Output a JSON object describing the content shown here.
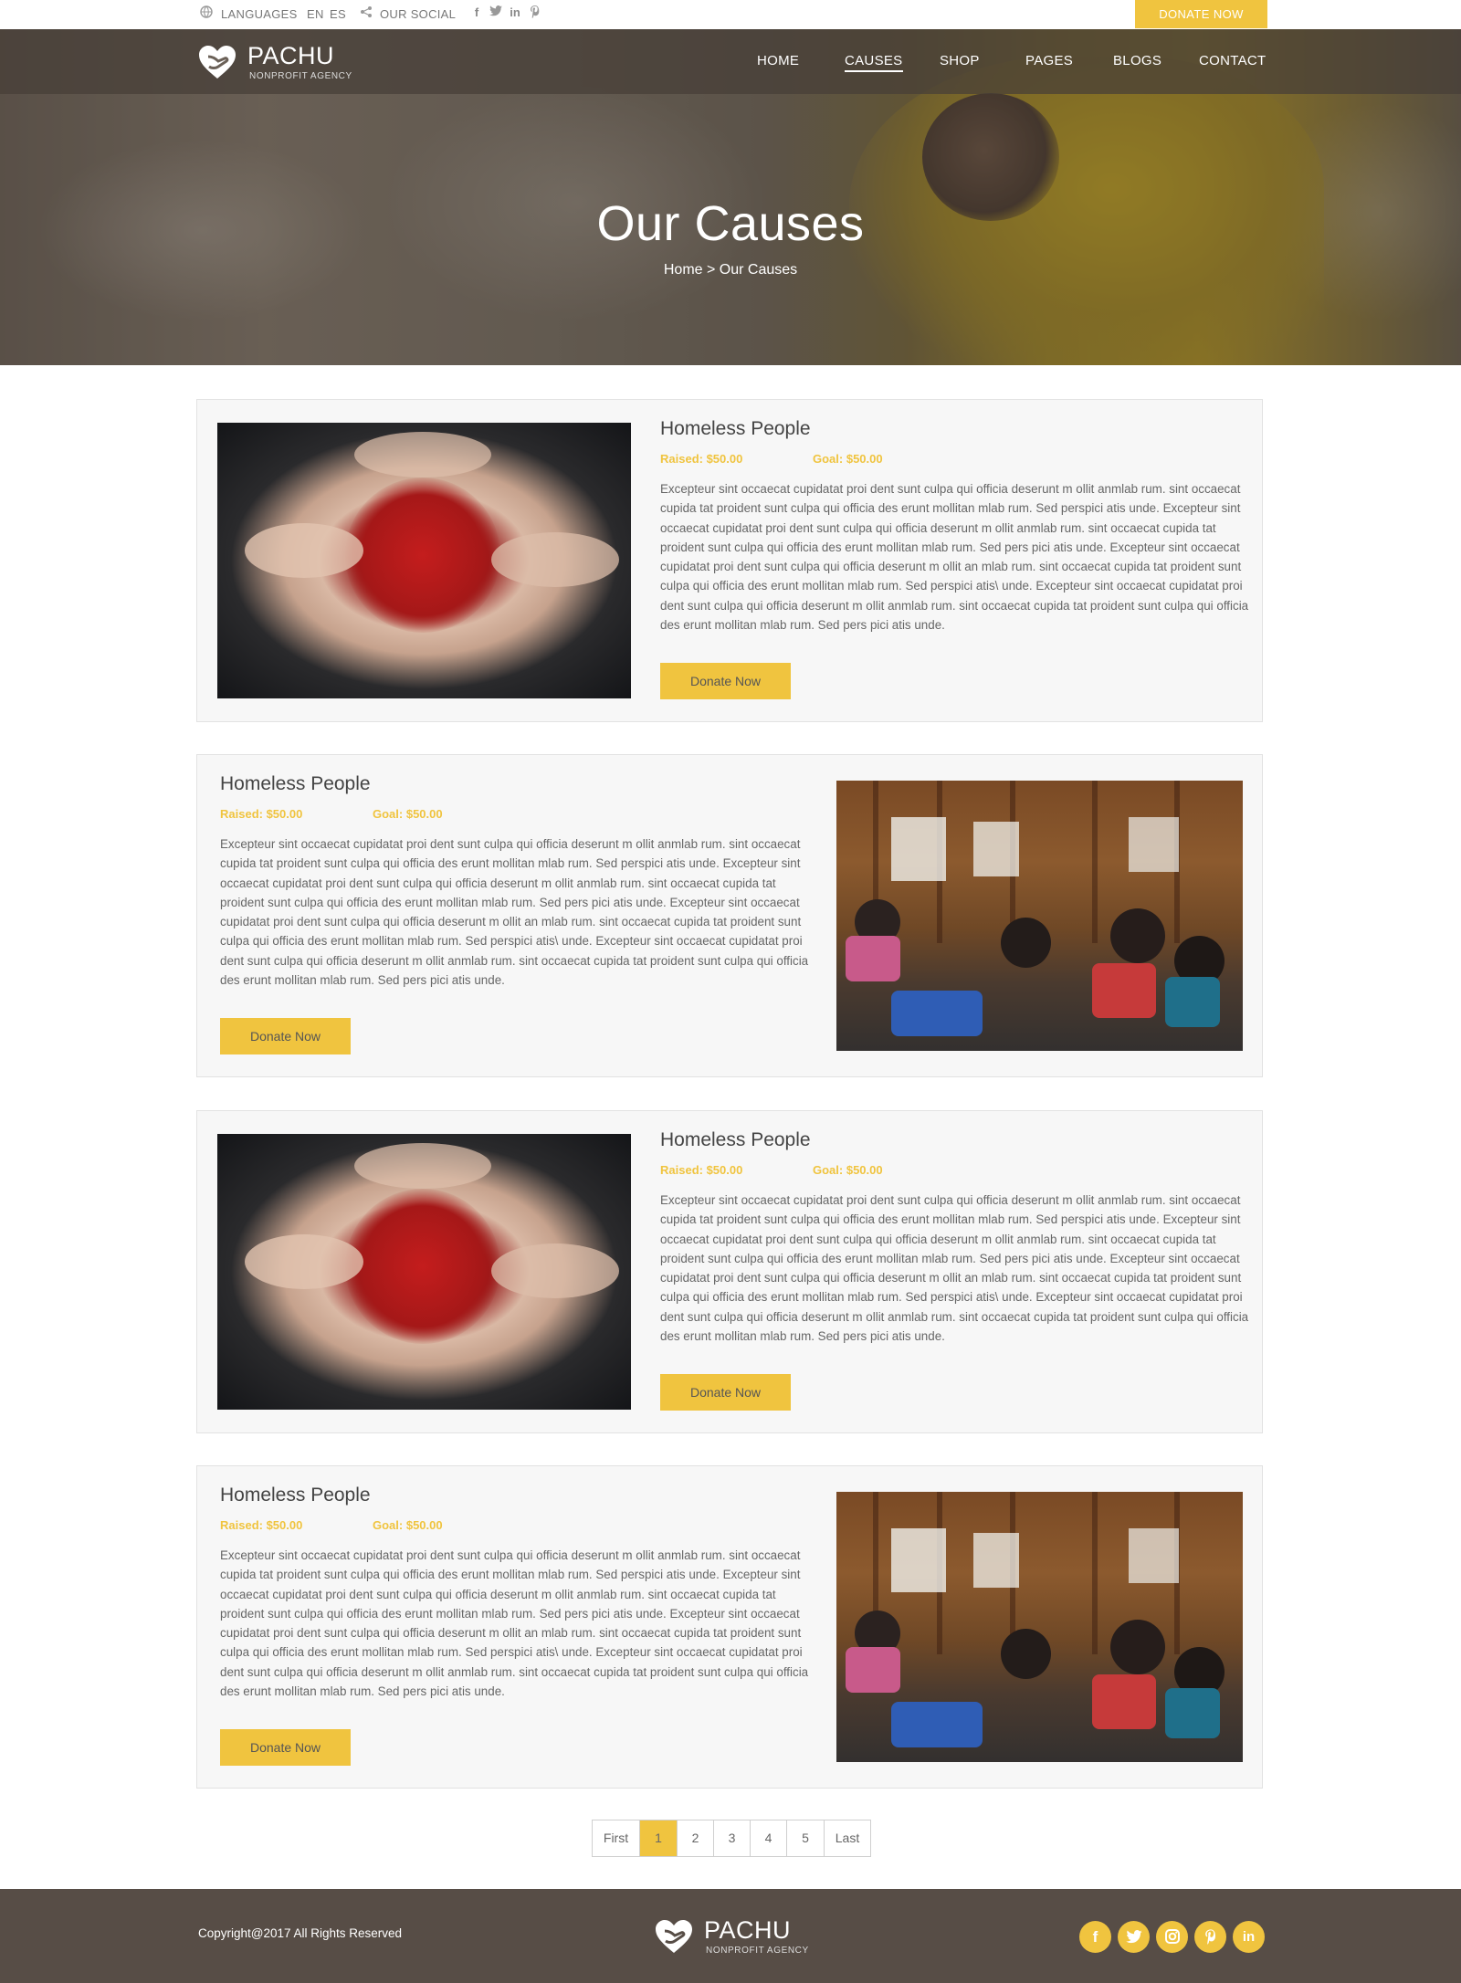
{
  "topbar": {
    "languages_label": "LANGUAGES",
    "lang_en": "EN",
    "lang_es": "ES",
    "social_label": "OUR SOCIAL",
    "social_icons": [
      "facebook-icon",
      "twitter-icon",
      "linkedin-icon",
      "pinterest-icon"
    ],
    "donate_label": "DONATE NOW"
  },
  "brand": {
    "name": "PACHU",
    "tagline": "NONPROFIT AGENCY"
  },
  "nav": {
    "items": [
      "HOME",
      "CAUSES",
      "SHOP",
      "PAGES",
      "BLOGS",
      "CONTACT"
    ],
    "active": "CAUSES"
  },
  "hero": {
    "title": "Our Causes",
    "breadcrumb": "Home > Our Causes"
  },
  "causes": [
    {
      "title": "Homeless People",
      "raised": "Raised: $50.00",
      "goal": "Goal: $50.00",
      "body": "Excepteur sint occaecat cupidatat proi dent sunt culpa qui officia deserunt m ollit anmlab rum. sint occaecat cupida tat proident sunt culpa qui officia des erunt mollitan mlab rum. Sed perspici atis unde. Excepteur sint occaecat cupidatat proi dent sunt culpa qui officia deserunt m ollit anmlab rum. sint occaecat cupida tat proident sunt culpa qui officia des erunt mollitan mlab rum. Sed pers pici atis unde. Excepteur sint occaecat cupidatat proi dent sunt culpa qui officia deserunt m ollit an mlab rum. sint occaecat cupida tat proident sunt culpa qui officia des erunt mollitan mlab rum. Sed perspici atis\\ unde. Excepteur sint occaecat cupidatat proi dent sunt culpa qui officia deserunt m ollit anmlab rum. sint occaecat cupida tat proident sunt culpa qui officia des erunt mollitan mlab rum. Sed pers pici atis unde.",
      "button": "Donate Now",
      "image": "painted-hands-photo"
    },
    {
      "title": "Homeless People",
      "raised": "Raised: $50.00",
      "goal": "Goal: $50.00",
      "body": "Excepteur sint occaecat cupidatat proi dent sunt culpa qui officia deserunt m ollit anmlab rum. sint occaecat cupida tat proident sunt culpa qui officia des erunt mollitan mlab rum. Sed perspici atis unde. Excepteur sint occaecat cupidatat proi dent sunt culpa qui officia deserunt m ollit anmlab rum. sint occaecat cupida tat proident sunt culpa qui officia des erunt mollitan mlab rum. Sed pers pici atis unde. Excepteur sint occaecat cupidatat proi dent sunt culpa qui officia deserunt m ollit an mlab rum. sint occaecat cupida tat proident sunt culpa qui officia des erunt mollitan mlab rum. Sed perspici atis\\ unde. Excepteur sint occaecat cupidatat proi dent sunt culpa qui officia deserunt m ollit anmlab rum. sint occaecat cupida tat proident sunt culpa qui officia des erunt mollitan mlab rum. Sed pers pici atis unde.",
      "button": "Donate Now",
      "image": "classroom-children-photo"
    },
    {
      "title": "Homeless People",
      "raised": "Raised: $50.00",
      "goal": "Goal: $50.00",
      "body": "Excepteur sint occaecat cupidatat proi dent sunt culpa qui officia deserunt m ollit anmlab rum. sint occaecat cupida tat proident sunt culpa qui officia des erunt mollitan mlab rum. Sed perspici atis unde. Excepteur sint occaecat cupidatat proi dent sunt culpa qui officia deserunt m ollit anmlab rum. sint occaecat cupida tat proident sunt culpa qui officia des erunt mollitan mlab rum. Sed pers pici atis unde. Excepteur sint occaecat cupidatat proi dent sunt culpa qui officia deserunt m ollit an mlab rum. sint occaecat cupida tat proident sunt culpa qui officia des erunt mollitan mlab rum. Sed perspici atis\\ unde. Excepteur sint occaecat cupidatat proi dent sunt culpa qui officia deserunt m ollit anmlab rum. sint occaecat cupida tat proident sunt culpa qui officia des erunt mollitan mlab rum. Sed pers pici atis unde.",
      "button": "Donate Now",
      "image": "painted-hands-photo"
    },
    {
      "title": "Homeless People",
      "raised": "Raised: $50.00",
      "goal": "Goal: $50.00",
      "body": "Excepteur sint occaecat cupidatat proi dent sunt culpa qui officia deserunt m ollit anmlab rum. sint occaecat cupida tat proident sunt culpa qui officia des erunt mollitan mlab rum. Sed perspici atis unde. Excepteur sint occaecat cupidatat proi dent sunt culpa qui officia deserunt m ollit anmlab rum. sint occaecat cupida tat proident sunt culpa qui officia des erunt mollitan mlab rum. Sed pers pici atis unde. Excepteur sint occaecat cupidatat proi dent sunt culpa qui officia deserunt m ollit an mlab rum. sint occaecat cupida tat proident sunt culpa qui officia des erunt mollitan mlab rum. Sed perspici atis\\ unde. Excepteur sint occaecat cupidatat proi dent sunt culpa qui officia deserunt m ollit anmlab rum. sint occaecat cupida tat proident sunt culpa qui officia des erunt mollitan mlab rum. Sed pers pici atis unde.",
      "button": "Donate Now",
      "image": "classroom-children-photo"
    }
  ],
  "pagination": {
    "first": "First",
    "pages": [
      "1",
      "2",
      "3",
      "4",
      "5"
    ],
    "current": "1",
    "last": "Last"
  },
  "footer": {
    "copyright": "Copyright@2017 All Rights Reserved",
    "social_icons": [
      "facebook-icon",
      "twitter-icon",
      "instagram-icon",
      "pinterest-icon",
      "linkedin-icon"
    ]
  },
  "colors": {
    "accent": "#f0c43f",
    "footer_bg": "#574d46",
    "card_bg": "#f7f7f7"
  }
}
